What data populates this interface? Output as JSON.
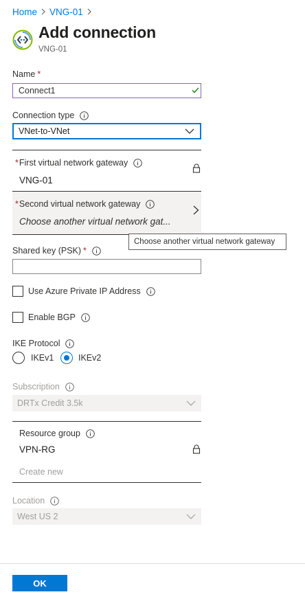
{
  "breadcrumb": [
    {
      "label": "Home"
    },
    {
      "label": "VNG-01"
    }
  ],
  "header": {
    "title": "Add connection",
    "subtitle": "VNG-01",
    "icon": "vpn-connection-icon"
  },
  "name": {
    "label": "Name",
    "required": "*",
    "value": "Connect1",
    "valid_icon": "checkmark-icon"
  },
  "connection_type": {
    "label": "Connection type",
    "value": "VNet-to-VNet"
  },
  "first_gateway": {
    "required": "*",
    "label": "First virtual network gateway",
    "value": "VNG-01",
    "locked_icon": "lock-icon"
  },
  "second_gateway": {
    "required": "*",
    "label": "Second virtual network gateway",
    "placeholder": "Choose another virtual network gat...",
    "tooltip": "Choose another virtual network gateway"
  },
  "shared_key": {
    "label": "Shared key (PSK)",
    "required": "*",
    "value": ""
  },
  "private_ip": {
    "label": "Use Azure Private IP Address",
    "checked": false
  },
  "bgp": {
    "label": "Enable BGP",
    "checked": false
  },
  "ike": {
    "label": "IKE Protocol",
    "options": [
      {
        "label": "IKEv1",
        "checked": false
      },
      {
        "label": "IKEv2",
        "checked": true
      }
    ]
  },
  "subscription": {
    "label": "Subscription",
    "value": "DRTx Credit 3.5k"
  },
  "resource_group": {
    "label": "Resource group",
    "value": "VPN-RG",
    "create_new": "Create new"
  },
  "location": {
    "label": "Location",
    "value": "West US 2"
  },
  "footer": {
    "ok_label": "OK"
  },
  "colors": {
    "accent": "#0078d4",
    "required": "#a4262c",
    "valid": "#107c10",
    "focus_border": "#8764b8",
    "disabled_bg": "#f3f2f1"
  }
}
